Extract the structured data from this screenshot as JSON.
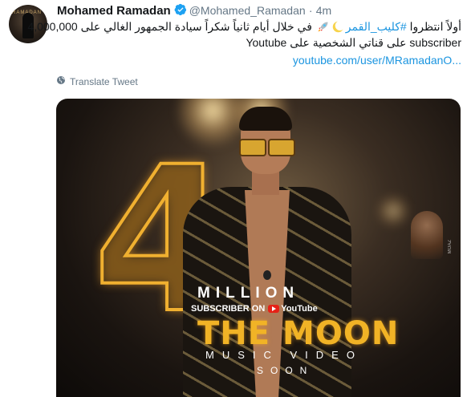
{
  "tweet": {
    "author_name": "Mohamed Ramadan",
    "handle": "@Mohamed_Ramadan",
    "separator": "·",
    "time": "4m",
    "line1_text": "أولاً انتظروا ",
    "line1_hashtag": "#كليب_القمر",
    "line1_rest": " في خلال أيام ثانياً شكراً سيادة الجمهور الغالي على 4,000,000",
    "line2_text": "subscriber على قناتي الشخصية على Youtube",
    "link_text": "youtube.com/user/MRamadanO...",
    "translate_label": "Translate Tweet"
  },
  "media": {
    "big_number": "4",
    "million_label": "MILLION",
    "subscriber_label": "SUBSCRIBER ON",
    "youtube_label": "YouTube",
    "title": "THE MOON",
    "subtitle": "MUSIC VIDEO",
    "soon_label": "SOON",
    "watermark": "MOAZ"
  },
  "icons": {
    "verified": "verified-badge-icon",
    "moon_emoji": "crescent-moon-emoji",
    "rocket_emoji": "rocket-emoji",
    "globe": "globe-icon"
  },
  "colors": {
    "link": "#1b95e0",
    "muted": "#657786",
    "accent_gold": "#f1b326"
  }
}
